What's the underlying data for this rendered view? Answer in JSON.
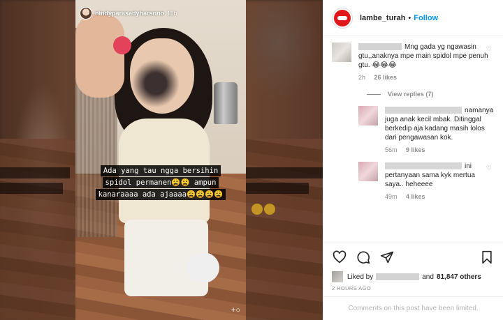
{
  "story": {
    "username": "nindyparasadyharsono",
    "time": "11h",
    "caption_lines": [
      "Ada yang tau ngga bersihin",
      "spidol permanen😩😩 ampun",
      "kanaraaaa ada ajaaaa😩😩😩😩"
    ],
    "corner_icon": "+ person-add-icon"
  },
  "post_header": {
    "username": "lambe_turah",
    "separator": "•",
    "follow_label": "Follow"
  },
  "comments": [
    {
      "text": "Mng gada yg ngawasin gtu,,anaknya mpe main spidol mpe penuh gtu. 😂😂😂",
      "time": "2h",
      "likes": "26 likes"
    }
  ],
  "view_replies": "View replies (7)",
  "replies": [
    {
      "text": "namanya juga anak kecil mbak. Ditinggal berkedip aja kadang masih lolos dari pengawasan kok.",
      "time": "56m",
      "likes": "9 likes"
    },
    {
      "text": "ini pertanyaan sama kyk mertua saya.. heheeee",
      "time": "49m",
      "likes": "4 likes"
    }
  ],
  "likes_row": {
    "prefix": "Liked by",
    "middle": "and",
    "count": "81,847 others"
  },
  "post_time": "2 HOURS AGO",
  "comments_limited": "Comments on this post have been limited.",
  "colors": {
    "follow": "#0095f6",
    "brand_red": "#e0181c",
    "muted": "#8e8e8e"
  },
  "icons": [
    "heart-icon",
    "comment-icon",
    "share-icon",
    "bookmark-icon"
  ]
}
